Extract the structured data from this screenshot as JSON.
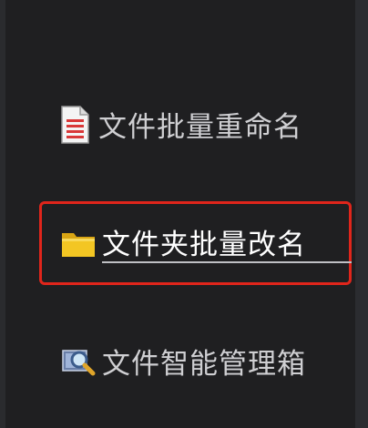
{
  "menu": {
    "items": [
      {
        "label": "文件批量重命名",
        "icon": "document-icon"
      },
      {
        "label": "文件夹批量改名",
        "icon": "folder-icon",
        "selected": true
      },
      {
        "label": "文件智能管理箱",
        "icon": "magnifier-icon"
      }
    ]
  },
  "colors": {
    "background": "#1f1f21",
    "text": "#cfcfd2",
    "highlight_border": "#e0251b",
    "folder": "#f3c623",
    "document_lines": "#d93838"
  }
}
